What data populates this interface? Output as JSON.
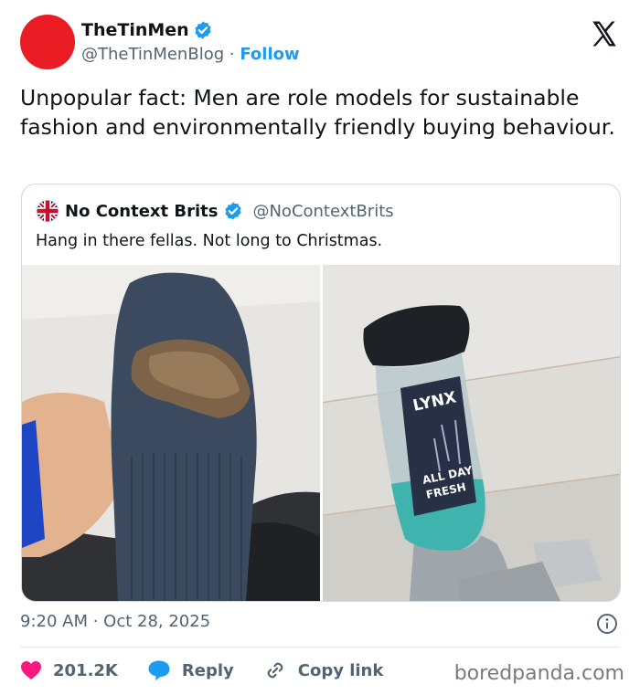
{
  "author": {
    "name": "TheTinMen",
    "handle": "@TheTinMenBlog",
    "separator": "·",
    "follow_label": "Follow",
    "avatar_color": "#ea1c24"
  },
  "tweet_text": "Unpopular fact: Men are role models for sustainable fashion and environmentally friendly buying behaviour.",
  "quoted": {
    "name": "No Context Brits",
    "handle": "@NoContextBrits",
    "text": "Hang in there fellas. Not long to Christmas.",
    "photos": [
      "worn-navy-sock-with-hole",
      "lynx-shower-gel-bottle-in-shower"
    ],
    "product_text": {
      "brand": "LYNX",
      "line1": "ALL DAY",
      "line2": "FRESH"
    }
  },
  "timestamp": "9:20 AM · Oct 28, 2025",
  "actions": {
    "likes": "201.2K",
    "reply_label": "Reply",
    "copy_label": "Copy link"
  },
  "watermark": "boredpanda.com",
  "colors": {
    "accent": "#1d9bf0",
    "like": "#f91880",
    "verified": "#1d9bf0",
    "muted": "#536471"
  },
  "icons": [
    "verified-badge-icon",
    "x-logo-icon",
    "uk-flag-icon",
    "info-icon",
    "heart-icon",
    "reply-bubble-icon",
    "link-icon"
  ]
}
